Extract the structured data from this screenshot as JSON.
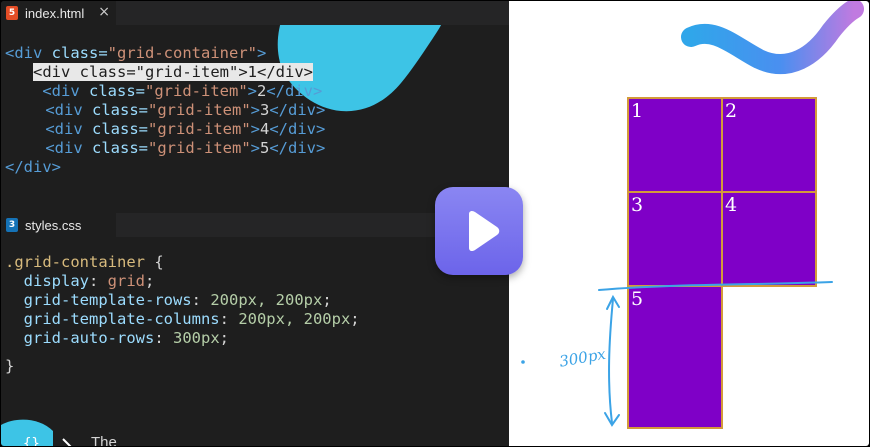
{
  "tabs": {
    "html": {
      "name": "index.html",
      "icon": "html5-icon",
      "icon_glyph": "5",
      "icon_color": "#e44d26",
      "close": "×"
    },
    "css": {
      "name": "styles.css",
      "icon": "css3-icon",
      "icon_glyph": "3",
      "icon_color": "#1572b6"
    }
  },
  "html_code": {
    "line1": {
      "lt": "<",
      "tag": "div",
      "attr": " class=",
      "str": "\"grid-container\"",
      "gt": ">"
    },
    "items": [
      {
        "indent": "   ",
        "open": "<",
        "tag": "div",
        "attr": " class=",
        "str": "\"grid-item\"",
        "close_gt": ">",
        "text": "1",
        "end": "</div>"
      },
      {
        "indent": "    ",
        "open": "<",
        "tag": "div",
        "attr": " class=",
        "str": "\"grid-item\"",
        "close_gt": ">",
        "text": "2",
        "end": "</div>"
      },
      {
        "indent": "    ",
        "open": "<",
        "tag": "div",
        "attr": " class=",
        "str": "\"grid-item\"",
        "close_gt": ">",
        "text": "3",
        "end": "</div>"
      },
      {
        "indent": "    ",
        "open": "<",
        "tag": "div",
        "attr": " class=",
        "str": "\"grid-item\"",
        "close_gt": ">",
        "text": "4",
        "end": "</div>"
      },
      {
        "indent": "    ",
        "open": "<",
        "tag": "div",
        "attr": " class=",
        "str": "\"grid-item\"",
        "close_gt": ">",
        "text": "5",
        "end": "</div>"
      }
    ],
    "line_last": "</div>"
  },
  "css_code": {
    "selector": ".grid-container",
    "open_brace": " {",
    "decls": [
      {
        "prop": "display",
        "value": "grid",
        "kind": "val"
      },
      {
        "prop": "grid-template-rows",
        "value": "200px, 200px",
        "kind": "num"
      },
      {
        "prop": "grid-template-columns",
        "value": "200px, 200px",
        "kind": "num"
      },
      {
        "prop": "grid-auto-rows",
        "value": "300px",
        "kind": "num"
      }
    ],
    "close_brace": "}"
  },
  "preview": {
    "items": [
      "1",
      "2",
      "3",
      "4",
      "5"
    ],
    "cell_color": "#7f00c7",
    "border_color": "#d49a3a",
    "annotation": "300px"
  },
  "colors": {
    "editor_bg": "#1e1e1e",
    "play_button": "#7b75ef",
    "ink": "#3ba3e6"
  },
  "bottom_text": "The"
}
